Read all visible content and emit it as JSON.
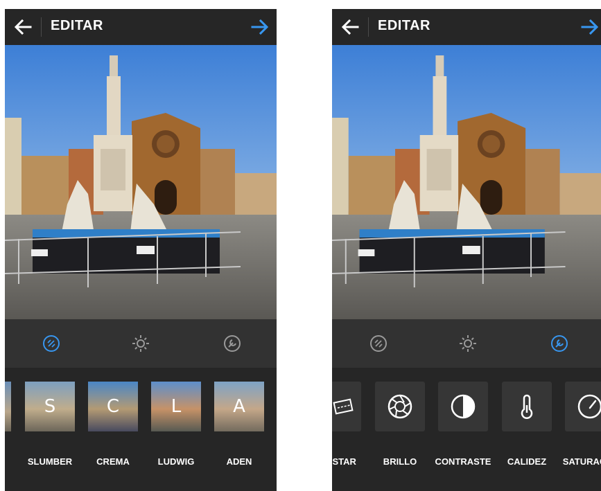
{
  "screen_title": "EDITAR",
  "colors": {
    "accent": "#3897f0",
    "bar": "#262626",
    "tools_bar": "#323232",
    "icon_inactive": "#9a9a9a"
  },
  "left": {
    "active_tool": "lux",
    "filters": [
      {
        "letter": "",
        "label": ""
      },
      {
        "letter": "S",
        "label": "SLUMBER"
      },
      {
        "letter": "C",
        "label": "CREMA"
      },
      {
        "letter": "L",
        "label": "LUDWIG"
      },
      {
        "letter": "A",
        "label": "ADEN"
      }
    ]
  },
  "right": {
    "active_tool": "edit",
    "adjustments": [
      {
        "icon": "adjust-icon",
        "label": "USTAR"
      },
      {
        "icon": "aperture-icon",
        "label": "BRILLO"
      },
      {
        "icon": "contrast-icon",
        "label": "CONTRASTE"
      },
      {
        "icon": "thermometer-icon",
        "label": "CALIDEZ"
      },
      {
        "icon": "gauge-icon",
        "label": "SATURAC"
      }
    ]
  }
}
